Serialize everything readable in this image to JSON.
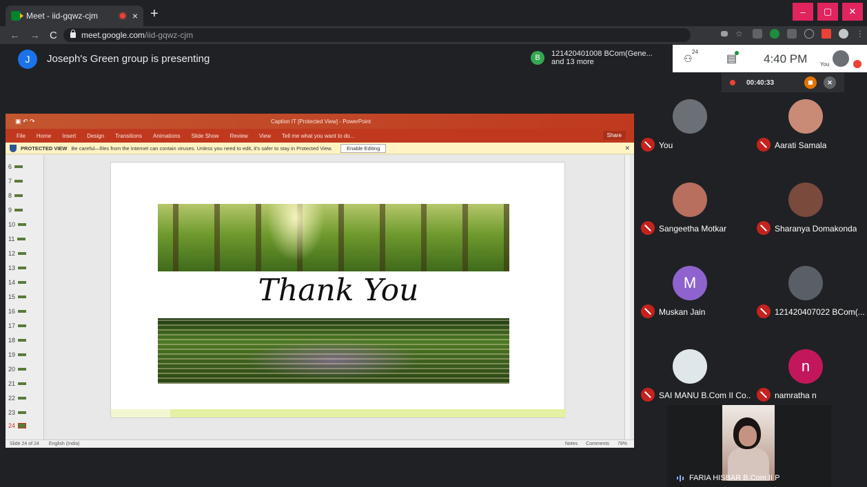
{
  "browser": {
    "tab_title": "Meet - iid-gqwz-cjm",
    "tab_close": "×",
    "new_tab": "+",
    "window_controls": [
      "–",
      "▢",
      "✕"
    ],
    "url_host": "meet.google.com",
    "url_path": "/iid-gqwz-cjm",
    "nav_back": "←",
    "nav_forward": "→",
    "nav_reload": "C"
  },
  "presenting": {
    "avatar_letter": "J",
    "text": "Joseph's Green group is presenting"
  },
  "notification": {
    "avatar_letter": "B",
    "line1": "121420401008 BCom(Gene...",
    "line2": "and 13 more"
  },
  "topbar": {
    "people_count": "24",
    "time": "4:40 PM",
    "you_label": "You"
  },
  "recording": {
    "timer": "00:40:33"
  },
  "powerpoint": {
    "window_title": "Caption IT [Protected View] - PowerPoint",
    "ribbon_tabs": [
      "File",
      "Home",
      "Insert",
      "Design",
      "Transitions",
      "Animations",
      "Slide Show",
      "Review",
      "View",
      "Tell me what you want to do..."
    ],
    "share_label": "Share",
    "protected_label": "PROTECTED VIEW",
    "protected_message": "Be careful—files from the Internet can contain viruses. Unless you need to edit, it's safer to stay in Protected View.",
    "enable_editing": "Enable Editing",
    "slide_numbers": [
      "6",
      "7",
      "8",
      "9",
      "10",
      "11",
      "12",
      "13",
      "14",
      "15",
      "16",
      "17",
      "18",
      "19",
      "20",
      "21",
      "22",
      "23",
      "24"
    ],
    "active_slide": "24",
    "slide_text": "Thank You",
    "status_slide": "Slide 24 of 24",
    "status_language": "English (India)",
    "status_notes": "Notes",
    "status_comments": "Comments",
    "status_zoom": "78%"
  },
  "participants": [
    {
      "name": "You",
      "avatar": "",
      "color": "#6b6f76"
    },
    {
      "name": "Aarati Samala",
      "avatar": "",
      "color": "#c98a76"
    },
    {
      "name": "Sangeetha Motkar",
      "avatar": "",
      "color": "#b86f5d"
    },
    {
      "name": "Sharanya Domakonda",
      "avatar": "",
      "color": "#7a4a3c"
    },
    {
      "name": "Muskan Jain",
      "avatar": "M",
      "color": "#8e63ce"
    },
    {
      "name": "121420407022 BCom(...",
      "avatar": "",
      "color": "#5a5e66"
    },
    {
      "name": "SAI MANU B.Com II Co...",
      "avatar": "",
      "color": "#dfe7ea"
    },
    {
      "name": "namratha n",
      "avatar": "n",
      "color": "#c2185b"
    }
  ],
  "self_view": {
    "name": "FARIA HISBAR B.Com II P"
  }
}
